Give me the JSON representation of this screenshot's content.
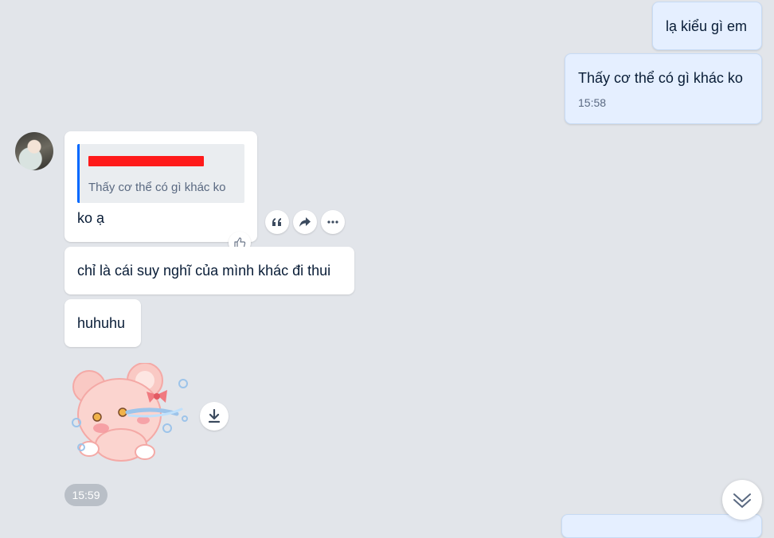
{
  "messages": {
    "sent_1": {
      "text": "lạ kiểu gì em"
    },
    "sent_2": {
      "text": "Thấy cơ thể có gì khác ko",
      "time": "15:58"
    },
    "received_1": {
      "quote_text": "Thấy cơ thể có gì khác ko",
      "text": "ko ạ"
    },
    "received_2": {
      "text": "chỉ là cái suy nghĩ của mình khác đi thui"
    },
    "received_3": {
      "text": "huhuhu"
    },
    "sticker": {
      "icon": "crying-pink-bear-sticker"
    },
    "received_time": "15:59"
  },
  "icons": {
    "reply": "quote-icon",
    "forward": "share-arrow-icon",
    "more": "more-dots-icon",
    "like": "thumbs-up-icon",
    "download": "download-icon",
    "scroll": "double-chevron-down-icon"
  },
  "colors": {
    "background": "#e2e5ea",
    "sent_bubble": "#e5efff",
    "received_bubble": "#ffffff",
    "quote_accent": "#0068ff",
    "redaction": "#ff1a1a"
  }
}
